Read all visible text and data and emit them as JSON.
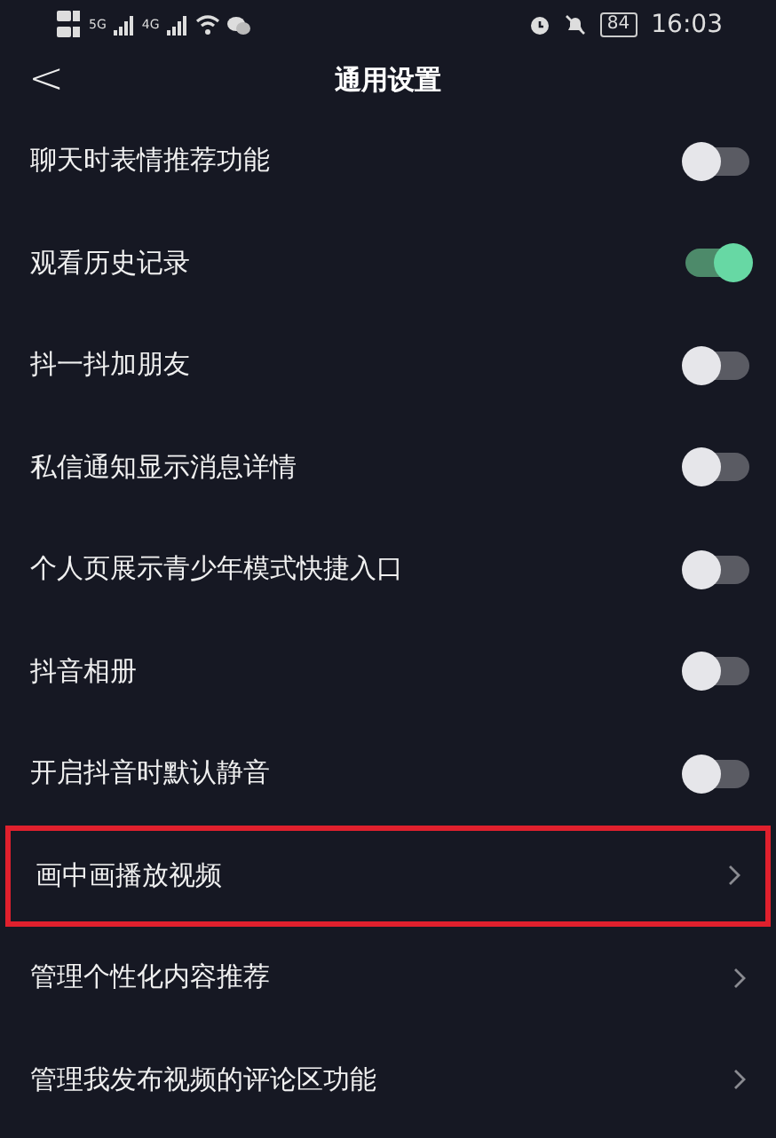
{
  "status_bar": {
    "network_1": "5G",
    "network_2": "4G",
    "battery": "84",
    "time": "16:03"
  },
  "header": {
    "back": "<",
    "title": "通用设置"
  },
  "rows": [
    {
      "kind": "toggle",
      "label": "聊天时表情推荐功能",
      "on": false
    },
    {
      "kind": "toggle",
      "label": "观看历史记录",
      "on": true
    },
    {
      "kind": "toggle",
      "label": "抖一抖加朋友",
      "on": false
    },
    {
      "kind": "toggle",
      "label": "私信通知显示消息详情",
      "on": false
    },
    {
      "kind": "toggle",
      "label": "个人页展示青少年模式快捷入口",
      "on": false
    },
    {
      "kind": "toggle",
      "label": "抖音相册",
      "on": false
    },
    {
      "kind": "toggle",
      "label": "开启抖音时默认静音",
      "on": false
    },
    {
      "kind": "link",
      "label": "画中画播放视频",
      "highlighted": true
    },
    {
      "kind": "link",
      "label": "管理个性化内容推荐",
      "highlighted": false
    },
    {
      "kind": "link",
      "label": "管理我发布视频的评论区功能",
      "highlighted": false
    }
  ]
}
